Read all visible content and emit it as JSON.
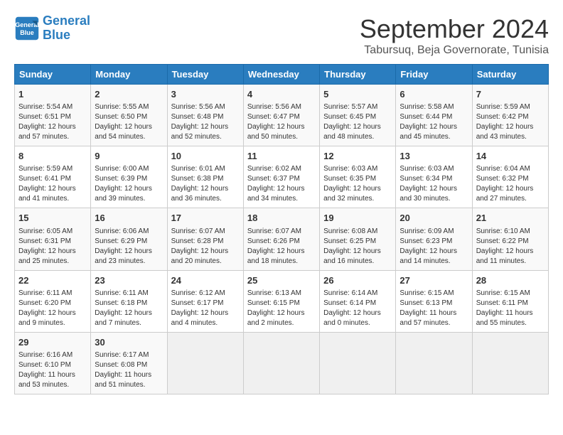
{
  "logo": {
    "line1": "General",
    "line2": "Blue"
  },
  "title": "September 2024",
  "subtitle": "Tabursuq, Beja Governorate, Tunisia",
  "headers": [
    "Sunday",
    "Monday",
    "Tuesday",
    "Wednesday",
    "Thursday",
    "Friday",
    "Saturday"
  ],
  "weeks": [
    [
      {
        "day": "1",
        "info": "Sunrise: 5:54 AM\nSunset: 6:51 PM\nDaylight: 12 hours\nand 57 minutes."
      },
      {
        "day": "2",
        "info": "Sunrise: 5:55 AM\nSunset: 6:50 PM\nDaylight: 12 hours\nand 54 minutes."
      },
      {
        "day": "3",
        "info": "Sunrise: 5:56 AM\nSunset: 6:48 PM\nDaylight: 12 hours\nand 52 minutes."
      },
      {
        "day": "4",
        "info": "Sunrise: 5:56 AM\nSunset: 6:47 PM\nDaylight: 12 hours\nand 50 minutes."
      },
      {
        "day": "5",
        "info": "Sunrise: 5:57 AM\nSunset: 6:45 PM\nDaylight: 12 hours\nand 48 minutes."
      },
      {
        "day": "6",
        "info": "Sunrise: 5:58 AM\nSunset: 6:44 PM\nDaylight: 12 hours\nand 45 minutes."
      },
      {
        "day": "7",
        "info": "Sunrise: 5:59 AM\nSunset: 6:42 PM\nDaylight: 12 hours\nand 43 minutes."
      }
    ],
    [
      {
        "day": "8",
        "info": "Sunrise: 5:59 AM\nSunset: 6:41 PM\nDaylight: 12 hours\nand 41 minutes."
      },
      {
        "day": "9",
        "info": "Sunrise: 6:00 AM\nSunset: 6:39 PM\nDaylight: 12 hours\nand 39 minutes."
      },
      {
        "day": "10",
        "info": "Sunrise: 6:01 AM\nSunset: 6:38 PM\nDaylight: 12 hours\nand 36 minutes."
      },
      {
        "day": "11",
        "info": "Sunrise: 6:02 AM\nSunset: 6:37 PM\nDaylight: 12 hours\nand 34 minutes."
      },
      {
        "day": "12",
        "info": "Sunrise: 6:03 AM\nSunset: 6:35 PM\nDaylight: 12 hours\nand 32 minutes."
      },
      {
        "day": "13",
        "info": "Sunrise: 6:03 AM\nSunset: 6:34 PM\nDaylight: 12 hours\nand 30 minutes."
      },
      {
        "day": "14",
        "info": "Sunrise: 6:04 AM\nSunset: 6:32 PM\nDaylight: 12 hours\nand 27 minutes."
      }
    ],
    [
      {
        "day": "15",
        "info": "Sunrise: 6:05 AM\nSunset: 6:31 PM\nDaylight: 12 hours\nand 25 minutes."
      },
      {
        "day": "16",
        "info": "Sunrise: 6:06 AM\nSunset: 6:29 PM\nDaylight: 12 hours\nand 23 minutes."
      },
      {
        "day": "17",
        "info": "Sunrise: 6:07 AM\nSunset: 6:28 PM\nDaylight: 12 hours\nand 20 minutes."
      },
      {
        "day": "18",
        "info": "Sunrise: 6:07 AM\nSunset: 6:26 PM\nDaylight: 12 hours\nand 18 minutes."
      },
      {
        "day": "19",
        "info": "Sunrise: 6:08 AM\nSunset: 6:25 PM\nDaylight: 12 hours\nand 16 minutes."
      },
      {
        "day": "20",
        "info": "Sunrise: 6:09 AM\nSunset: 6:23 PM\nDaylight: 12 hours\nand 14 minutes."
      },
      {
        "day": "21",
        "info": "Sunrise: 6:10 AM\nSunset: 6:22 PM\nDaylight: 12 hours\nand 11 minutes."
      }
    ],
    [
      {
        "day": "22",
        "info": "Sunrise: 6:11 AM\nSunset: 6:20 PM\nDaylight: 12 hours\nand 9 minutes."
      },
      {
        "day": "23",
        "info": "Sunrise: 6:11 AM\nSunset: 6:18 PM\nDaylight: 12 hours\nand 7 minutes."
      },
      {
        "day": "24",
        "info": "Sunrise: 6:12 AM\nSunset: 6:17 PM\nDaylight: 12 hours\nand 4 minutes."
      },
      {
        "day": "25",
        "info": "Sunrise: 6:13 AM\nSunset: 6:15 PM\nDaylight: 12 hours\nand 2 minutes."
      },
      {
        "day": "26",
        "info": "Sunrise: 6:14 AM\nSunset: 6:14 PM\nDaylight: 12 hours\nand 0 minutes."
      },
      {
        "day": "27",
        "info": "Sunrise: 6:15 AM\nSunset: 6:13 PM\nDaylight: 11 hours\nand 57 minutes."
      },
      {
        "day": "28",
        "info": "Sunrise: 6:15 AM\nSunset: 6:11 PM\nDaylight: 11 hours\nand 55 minutes."
      }
    ],
    [
      {
        "day": "29",
        "info": "Sunrise: 6:16 AM\nSunset: 6:10 PM\nDaylight: 11 hours\nand 53 minutes."
      },
      {
        "day": "30",
        "info": "Sunrise: 6:17 AM\nSunset: 6:08 PM\nDaylight: 11 hours\nand 51 minutes."
      },
      {
        "day": "",
        "info": ""
      },
      {
        "day": "",
        "info": ""
      },
      {
        "day": "",
        "info": ""
      },
      {
        "day": "",
        "info": ""
      },
      {
        "day": "",
        "info": ""
      }
    ]
  ]
}
